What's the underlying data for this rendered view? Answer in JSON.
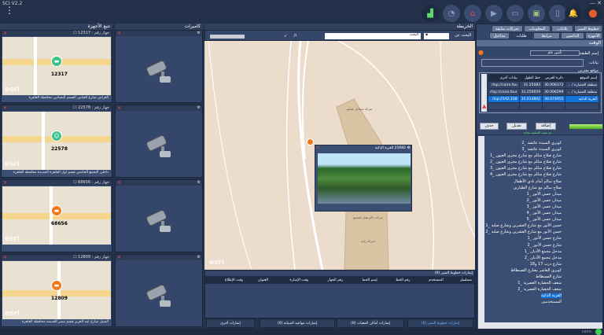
{
  "app": {
    "title": "SCI V2.2",
    "window_controls": "— ✕"
  },
  "toolbar_icons": [
    "chart-icon",
    "speedometer-icon",
    "home-icon",
    "video-icon",
    "briefcase-icon",
    "monitor-user-icon",
    "mobile-icon",
    "bell-icon",
    "map-pin-icon"
  ],
  "tracking": {
    "title": "تتبع الأجهزة",
    "devices": [
      {
        "header": "جهاز رقم : 12317",
        "id": "12317",
        "address": "العراش شارع العباس القسم البساتين محافظة القاهرة",
        "pin_color": "#3ec28f"
      },
      {
        "header": "جهاز رقم : 22578",
        "id": "22578",
        "address": "داخلي التجمع الخامس قسم اول القاهرة الجديدة محافظة القاهرة",
        "pin_color": "#3ec28f"
      },
      {
        "header": "جهاز رقم : 68656",
        "id": "68656",
        "address": "",
        "pin_color": "#f07a1a"
      },
      {
        "header": "جهاز رقم : 12809",
        "id": "12809",
        "address": "المنيل شارع عبد العزيز قسم مصر القديمة محافظة القاهرة",
        "pin_color": "#f07a1a"
      }
    ],
    "esri": "esri"
  },
  "cameras": {
    "title": "كاميرات"
  },
  "map": {
    "title": "الخريطة",
    "search_label": "البحث عن",
    "search_type": "",
    "search_value": "البحث",
    "popup_title": "25682 القرية الذكية",
    "labels": [
      "شركة مسائل شتايم",
      "شركة داكو هيلز للتجمع",
      "شركة زلبة"
    ],
    "esri": "esri"
  },
  "alerts": {
    "title": "إشارات خطوط السير (0)",
    "columns": [
      "مسلسل",
      "المستخدم",
      "رقم الخط",
      "إسم الخط",
      "رقم الجهاز",
      "وقت الإشارة",
      "العنوان",
      "وقت الإطلاع"
    ],
    "tabs": [
      "إشارات خطوط السير (0)",
      "إشارات أماكن المعيات (0)",
      "إشارات الشرطة (0)",
      "إشارات مواعيد الصيانة (0)",
      "إشارات أخرى"
    ]
  },
  "right": {
    "tabs_row1": [
      "خطوط السير",
      "بلاغات",
      "المعلومات",
      "تحركات سابقة"
    ],
    "tabs_row2": [
      "الأجهزة",
      "الدائمين",
      "مرابط",
      "طلبات",
      "مداخيل"
    ],
    "section": "الوقت",
    "layer_label": "إسم الطبقة",
    "layer_value": "تأمين عام",
    "data_label": "بيانات",
    "locations_title": "مواقع مفترض",
    "columns": [
      "إسم الموقع",
      "دائرة العرض",
      "خط الطول",
      "بيانات أخرى"
    ],
    "rows": [
      [
        "منطقة الحضارة / ...",
        "30.006372",
        "31.25083",
        "rtsp://cairo.fou"
      ],
      [
        "منطقة الحضارة / ...",
        "30.006299",
        "31.250059",
        "rtsp://cairo.four"
      ],
      [
        "القرية الذكية",
        "30.074955",
        "31.014802",
        "rtsp://192.168"
      ]
    ],
    "selected_row": 2,
    "add": "إضافة",
    "edit": "تعديل",
    "delete": "حذف",
    "progress": 100,
    "status": "تم تنفيذ العملية بنجاح",
    "list": [
      "كوبري السيدة عائشة _2",
      "كوبري السيدة عائشة _3",
      "شارع صلاح سالم مع شارع مجرى العيون _1",
      "شارع صلاح سالم مع شارع مجرى العيون _2",
      "شارع صلاح سالم مع شارع مجرى العيون _3",
      "شارع صلاح سالم مع شارع مجرى العيون _4",
      "صلاح سالم أمام نادي الأطفال",
      "صلاح سالم مع شارع الطيارين",
      "ميدان حسن الأنور _1",
      "ميدان حسن الأنور _2",
      "ميدان حسن الأنور _3",
      "ميدان حسن الأنور _4",
      "ميدان حسن الأنور _5",
      "حسن الأنور مع شارع العشرين وشارع صلبة _1",
      "حسن الأنور مع شارع العشرين وشارع صلبة _2",
      "شارع حسن الأنور _1",
      "شارع حسن الأنور _2",
      "مدخل مجمع الأديان _1",
      "مدخل مجمع الأديان _2",
      "شارع درب 17 و18",
      "كوبري العاشر بشارع الفسطاط",
      "شارع الفسطاط",
      "شعف الحضارة العصرية _1",
      "شعف الحضارة العصرية _2",
      "القرية الذكية",
      "المستخدمين"
    ],
    "selected_item": 24
  },
  "statusbar": {
    "city": "cairo"
  }
}
